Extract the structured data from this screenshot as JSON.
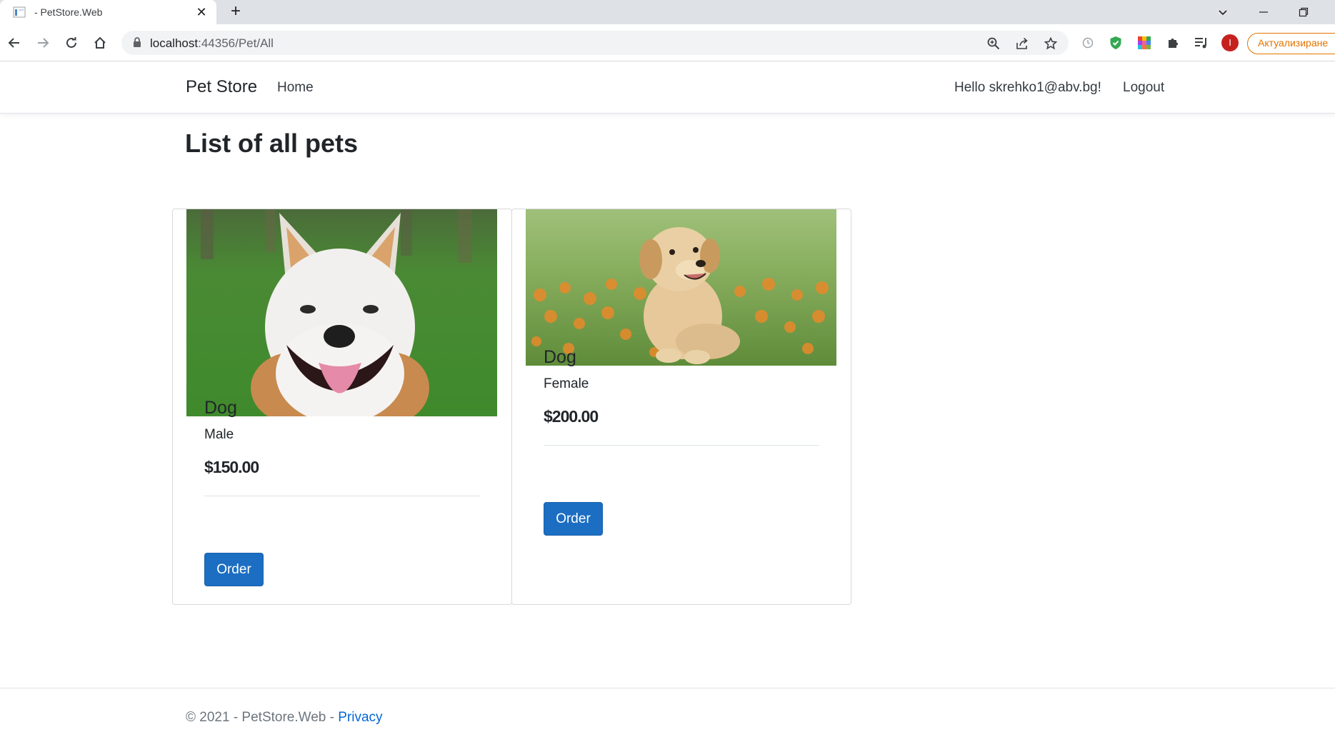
{
  "browser": {
    "tab_title": "- PetStore.Web",
    "url_host": "localhost",
    "url_path": ":44356/Pet/All",
    "profile_initial": "I",
    "update_label": "Актуализиране"
  },
  "navbar": {
    "brand": "Pet Store",
    "home": "Home",
    "greeting": "Hello skrehko1@abv.bg!",
    "logout": "Logout"
  },
  "page": {
    "title": "List of all pets"
  },
  "pets": [
    {
      "name": "Dog",
      "gender": "Male",
      "price": "$150.00",
      "order_label": "Order"
    },
    {
      "name": "Dog",
      "gender": "Female",
      "price": "$200.00",
      "order_label": "Order"
    }
  ],
  "footer": {
    "text": "© 2021 - PetStore.Web - ",
    "privacy": "Privacy"
  },
  "colors": {
    "primary_button": "#1b6ec2",
    "link": "#0366d6",
    "update_accent": "#e37400"
  }
}
